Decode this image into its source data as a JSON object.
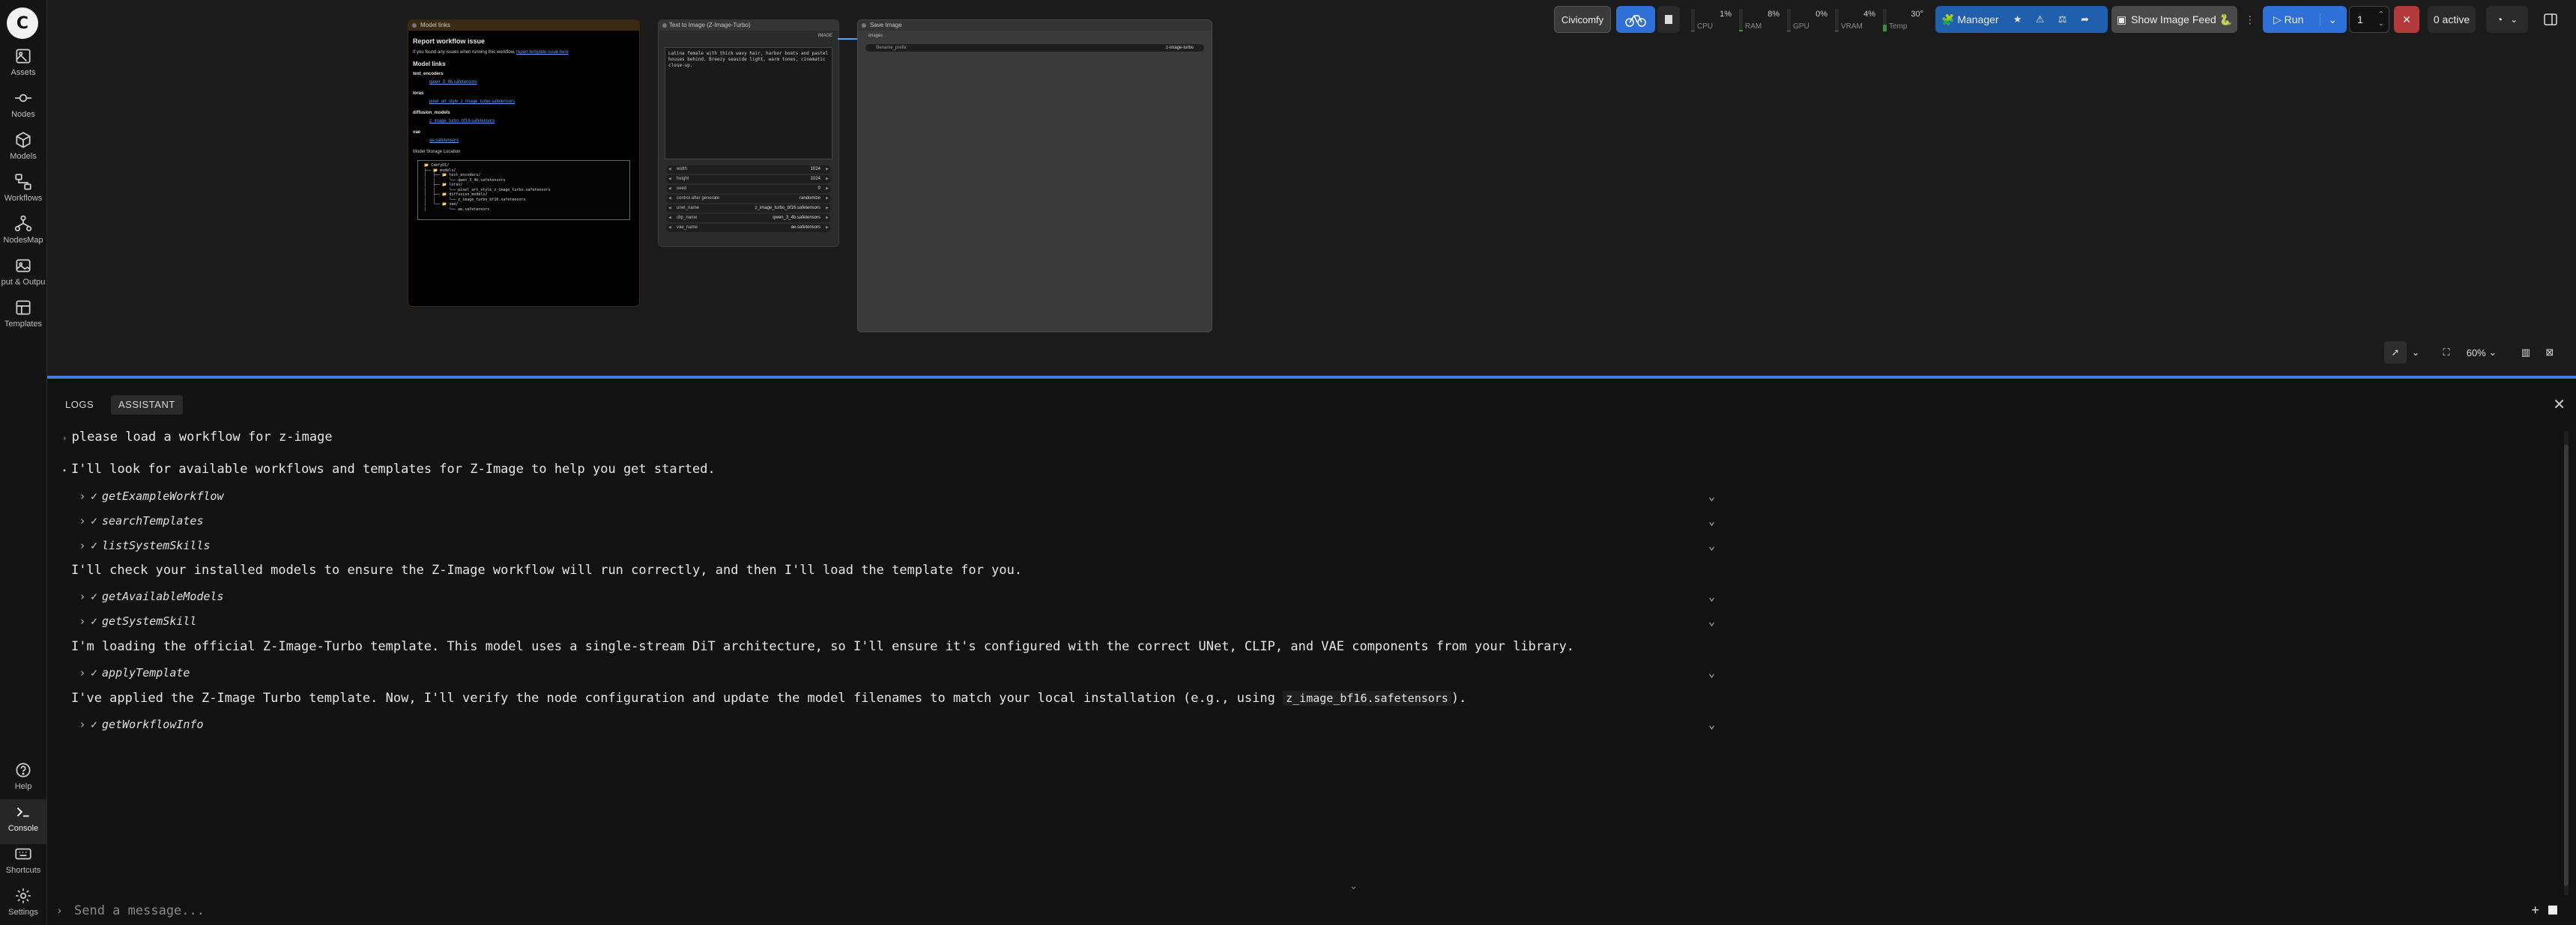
{
  "sidebar": {
    "logo_glyph": "C",
    "items": [
      {
        "label": "Assets",
        "icon": "assets-icon"
      },
      {
        "label": "Nodes",
        "icon": "nodes-icon"
      },
      {
        "label": "Models",
        "icon": "models-icon"
      },
      {
        "label": "Workflows",
        "icon": "workflows-icon"
      },
      {
        "label": "NodesMap",
        "icon": "nodesmap-icon"
      },
      {
        "label": "put & Outpu",
        "icon": "input-output-icon"
      },
      {
        "label": "Templates",
        "icon": "templates-icon"
      },
      {
        "label": "Help",
        "icon": "help-icon"
      },
      {
        "label": "Console",
        "icon": "console-icon"
      },
      {
        "label": "Shortcuts",
        "icon": "shortcuts-icon"
      },
      {
        "label": "Settings",
        "icon": "settings-icon"
      }
    ]
  },
  "canvas": {
    "note_node": {
      "title": "Model links",
      "heading": "Report workflow issue",
      "intro": "If you found any issues when running this workflow,",
      "intro_link": "report template issue here",
      "section": "Model links",
      "groups": [
        {
          "name": "text_encoders",
          "link": "qwen_3_4b.safetensors"
        },
        {
          "name": "loras",
          "link": "pixel_art_style_z_image_turbo.safetensors"
        },
        {
          "name": "diffusion_models",
          "link": "z_image_turbo_bf16.safetensors"
        },
        {
          "name": "vae",
          "link": "ae.safetensors"
        }
      ],
      "storage_label": "Model Storage Location",
      "tree": "📂 ComfyUI/\n├── 📂 models/\n│   ├── 📂 text_encoders/\n│   │      └── qwen_3_4b.safetensors\n│   ├── 📂 loras/\n│   │      └── pixel_art_style_z_image_turbo.safetensors\n│   ├── 📂 diffusion_models/\n│   │      └── z_image_turbo_bf16.safetensors\n│   └── 📂 vae/\n│          └── ae.safetensors"
    },
    "t2i_node": {
      "title": "Text to Image (Z-Image-Turbo)",
      "output": "IMAGE",
      "prompt": "Latina female with thick wavy hair, harbor boats and pastel houses behind. Breezy seaside light, warm tones, cinematic close-up.",
      "widgets": [
        {
          "name": "width",
          "value": "1024"
        },
        {
          "name": "height",
          "value": "1024"
        },
        {
          "name": "seed",
          "value": "0"
        },
        {
          "name": "control after generate",
          "value": "randomize"
        },
        {
          "name": "unet_name",
          "value": "z_image_turbo_bf16.safetensors"
        },
        {
          "name": "clip_name",
          "value": "qwen_3_4b.safetensors"
        },
        {
          "name": "vae_name",
          "value": "ae.safetensors"
        }
      ]
    },
    "save_node": {
      "title": "Save Image",
      "input": "images",
      "filename_label": "filename_prefix",
      "filename_value": "z-image-turbo"
    },
    "zoom": "60%"
  },
  "toolbar": {
    "civicomfy": "Civicomfy",
    "meters": [
      {
        "name": "CPU",
        "value": "1%",
        "level": 0.01
      },
      {
        "name": "RAM",
        "value": "8%",
        "level": 0.08
      },
      {
        "name": "GPU",
        "value": "0%",
        "level": 0.0
      },
      {
        "name": "VRAM",
        "value": "4%",
        "level": 0.04
      },
      {
        "name": "Temp",
        "value": "30°",
        "level": 0.3
      }
    ],
    "manager": "Manager",
    "show_feed": "Show Image Feed 🐍",
    "run": "Run",
    "queue_count": "1",
    "active": "0 active"
  },
  "panel": {
    "tabs": [
      "LOGS",
      "ASSISTANT"
    ],
    "messages": [
      {
        "kind": "user",
        "text": "please load a workflow for z-image"
      },
      {
        "kind": "assistant",
        "text": "I'll look for available workflows and templates for Z-Image to help you get started."
      },
      {
        "kind": "tool",
        "text": "getExampleWorkflow"
      },
      {
        "kind": "tool",
        "text": "searchTemplates"
      },
      {
        "kind": "tool",
        "text": "listSystemSkills"
      },
      {
        "kind": "assistant",
        "text": "I'll check your installed models to ensure the Z-Image workflow will run correctly, and then I'll load the template for you."
      },
      {
        "kind": "tool",
        "text": "getAvailableModels"
      },
      {
        "kind": "tool",
        "text": "getSystemSkill"
      },
      {
        "kind": "assistant",
        "text": "I'm loading the official Z-Image-Turbo template. This model uses a single-stream DiT architecture, so I'll ensure it's configured with the correct UNet, CLIP, and VAE components from your library."
      },
      {
        "kind": "tool",
        "text": "applyTemplate"
      },
      {
        "kind": "assistant_code",
        "text": "I've applied the Z-Image Turbo template. Now, I'll verify the node configuration and update the model filenames to match your local installation (e.g., using ",
        "code": "z_image_bf16.safetensors",
        "tail": ")."
      },
      {
        "kind": "tool",
        "text": "getWorkflowInfo"
      }
    ],
    "composer_placeholder": "Send a message..."
  }
}
